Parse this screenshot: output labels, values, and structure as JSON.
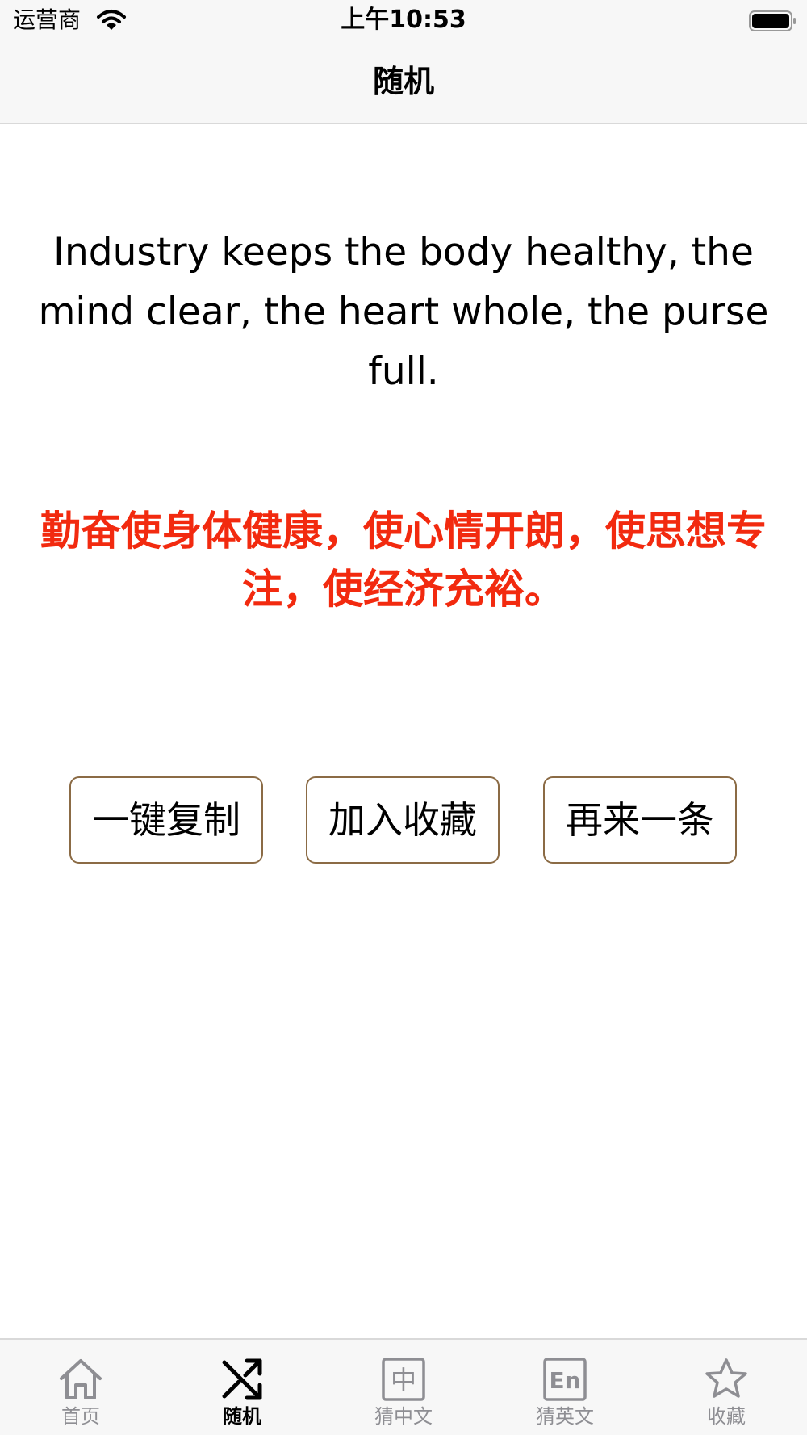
{
  "status_bar": {
    "carrier": "运营商",
    "time": "上午10:53"
  },
  "nav": {
    "title": "随机"
  },
  "quote": {
    "english": "Industry keeps the body healthy, the mind clear, the heart whole, the purse full.",
    "chinese": "勤奋使身体健康，使心情开朗，使思想专注，使经济充裕。"
  },
  "actions": {
    "copy_label": "一键复制",
    "favorite_label": "加入收藏",
    "next_label": "再来一条"
  },
  "tabs": [
    {
      "label": "首页",
      "icon": "home-icon",
      "active": false
    },
    {
      "label": "随机",
      "icon": "shuffle-icon",
      "active": true
    },
    {
      "label": "猜中文",
      "icon": "zh-char-icon",
      "active": false,
      "icon_text": "中"
    },
    {
      "label": "猜英文",
      "icon": "en-letters-icon",
      "active": false,
      "icon_text": "En"
    },
    {
      "label": "收藏",
      "icon": "star-icon",
      "active": false
    }
  ],
  "colors": {
    "chinese_text": "#f22a0f",
    "button_border": "#8b6b45",
    "tab_inactive": "#8e8e93",
    "bar_background": "#f7f7f7"
  }
}
